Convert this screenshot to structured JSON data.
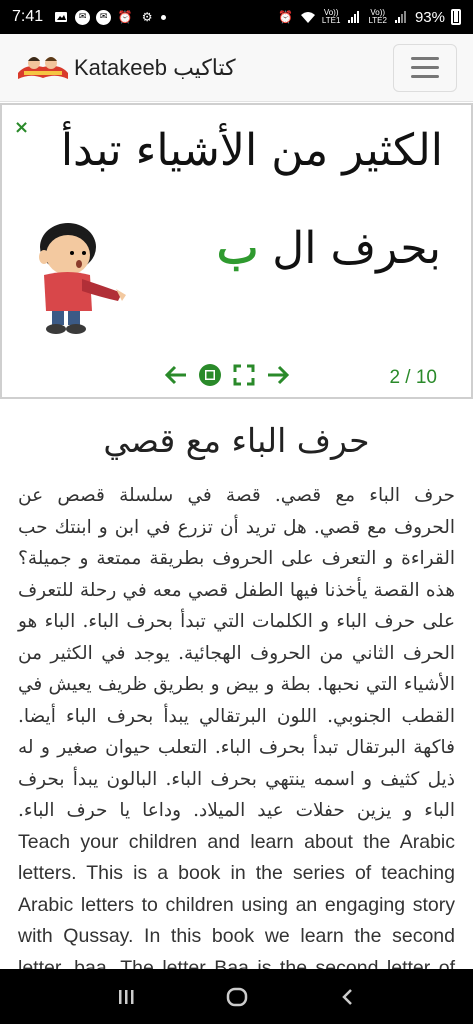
{
  "status_bar": {
    "time": "7:41",
    "battery": "93%",
    "lte1": "Vo))\nLTE1",
    "lte2": "Vo))\nLTE2"
  },
  "navbar": {
    "brand": "Katakeeb كتاكيب"
  },
  "viewer": {
    "close_label": "×",
    "line1": "الكثير من الأشياء تبدأ",
    "line2_prefix": "بحرف ال",
    "line2_letter": "ب",
    "page_counter": "2 / 10",
    "accent_color": "#2a8a2a"
  },
  "content": {
    "title": "حرف الباء مع قصي",
    "description_ar": "حرف الباء مع قصي. قصة في سلسلة قصص عن الحروف مع قصي. هل تريد أن تزرع في ابن و ابنتك حب القراءة و التعرف على الحروف بطريقة ممتعة و جميلة؟ هذه القصة يأخذنا فيها الطفل قصي معه في رحلة للتعرف على حرف الباء و الكلمات التي تبدأ بحرف الباء. الباء هو الحرف الثاني من الحروف الهجائية. يوجد في الكثير من الأشياء التي نحبها. بطة و بيض و بطريق ظريف يعيش في القطب الجنوبي. اللون البرتقالي يبدأ بحرف الباء أيضا. فاكهة البرتقال تبدأ بحرف الباء. التعلب حيوان صغير و له ذيل كثيف و اسمه ينتهي بحرف الباء. البالون يبدأ بحرف الباء و يزين حفلات عيد الميلاد. وداعا يا حرف الباء.",
    "description_en": "Teach your children and learn about the Arabic letters. This is a book in the series of teaching Arabic letters to children using an engaging story with Qussay. In this book we learn the second letter, baa. The letter Baa is the second letter of the alphabet. There are many"
  },
  "icons": [
    "wifi-icon",
    "signal-icon",
    "alarm-icon",
    "menu-icon",
    "back-arrow-icon",
    "stop-icon",
    "fullscreen-icon",
    "forward-arrow-icon",
    "recents-icon",
    "home-icon",
    "back-icon"
  ]
}
